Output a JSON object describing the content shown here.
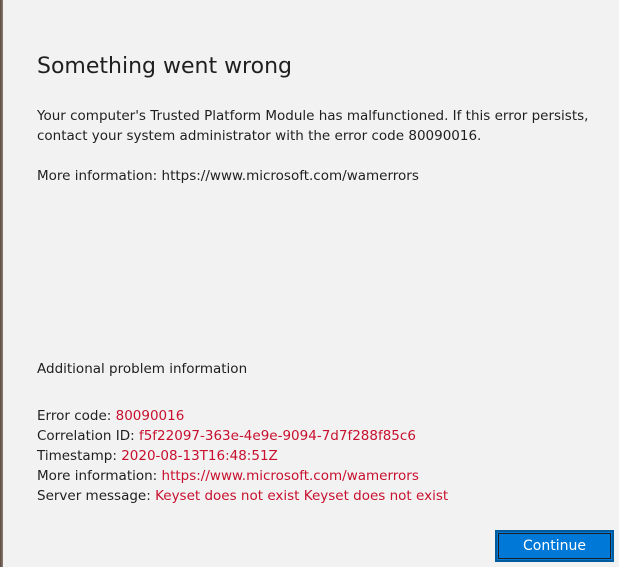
{
  "dialog": {
    "title": "Something went wrong",
    "message": "Your computer's Trusted Platform Module has malfunctioned. If this error persists, contact your system administrator with the error code 80090016.",
    "more_info_top": "More information: https://www.microsoft.com/wamerrors",
    "additional_heading": "Additional problem information",
    "details": {
      "error_code_label": "Error code: ",
      "error_code_value": "80090016",
      "correlation_id_label": "Correlation ID: ",
      "correlation_id_value": "f5f22097-363e-4e9e-9094-7d7f288f85c6",
      "timestamp_label": "Timestamp: ",
      "timestamp_value": "2020-08-13T16:48:51Z",
      "more_info_label": "More information: ",
      "more_info_value": "https://www.microsoft.com/wamerrors",
      "server_message_label": "Server message: ",
      "server_message_value": "Keyset does not exist Keyset does not exist"
    },
    "continue_label": "Continue"
  },
  "colors": {
    "background": "#f2f2f2",
    "accent": "#0078d7",
    "error_value": "#c8102e",
    "text": "#1f1f1f"
  }
}
